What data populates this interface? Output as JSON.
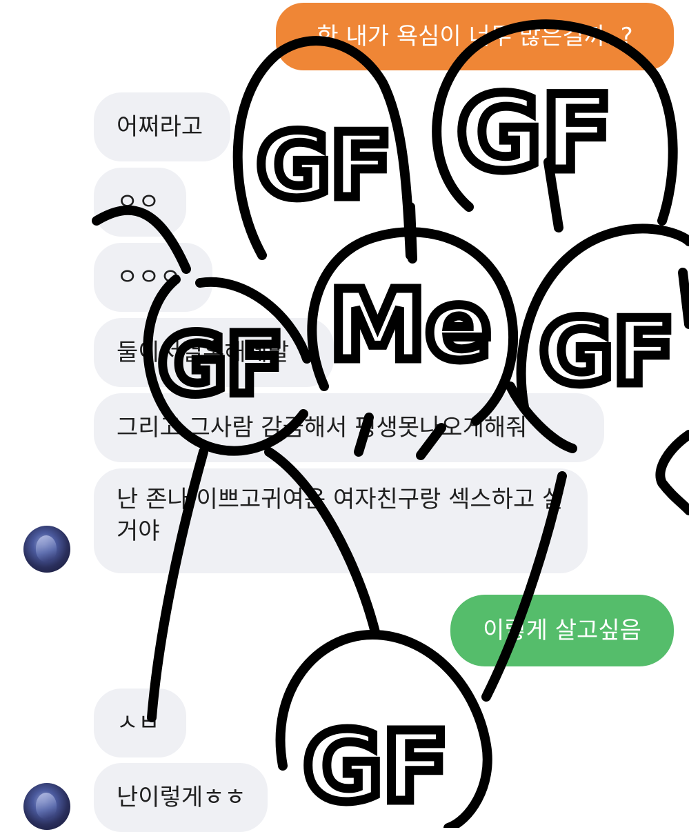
{
  "chat": {
    "messages": [
      {
        "side": "sent",
        "color": "#ef8636",
        "text": "한 내가 욕심이 너무 많은걸까..?"
      },
      {
        "side": "received",
        "text": "어쩌라고"
      },
      {
        "side": "received",
        "text": "ㅇㅇ"
      },
      {
        "side": "received",
        "text": "ㅇㅇㅇ"
      },
      {
        "side": "received",
        "text": "둘이서결혼해제발"
      },
      {
        "side": "received",
        "text": "그리고 그사람 감금해서 평생못나오게해줘"
      },
      {
        "side": "received",
        "text": "난 존나 이쁘고귀여운 여자친구랑 섹스하고 살거야"
      },
      {
        "side": "sent",
        "color": "#55bd6b",
        "text": "이렇게 살고싶음"
      },
      {
        "side": "received",
        "text": "ㅅㅂ"
      },
      {
        "side": "received",
        "text": "난이렇게ㅎㅎ"
      }
    ]
  },
  "doodle": {
    "labels": [
      "GF",
      "GF",
      "GF",
      "Me",
      "GF",
      "GF"
    ],
    "stroke_color": "#000000"
  }
}
